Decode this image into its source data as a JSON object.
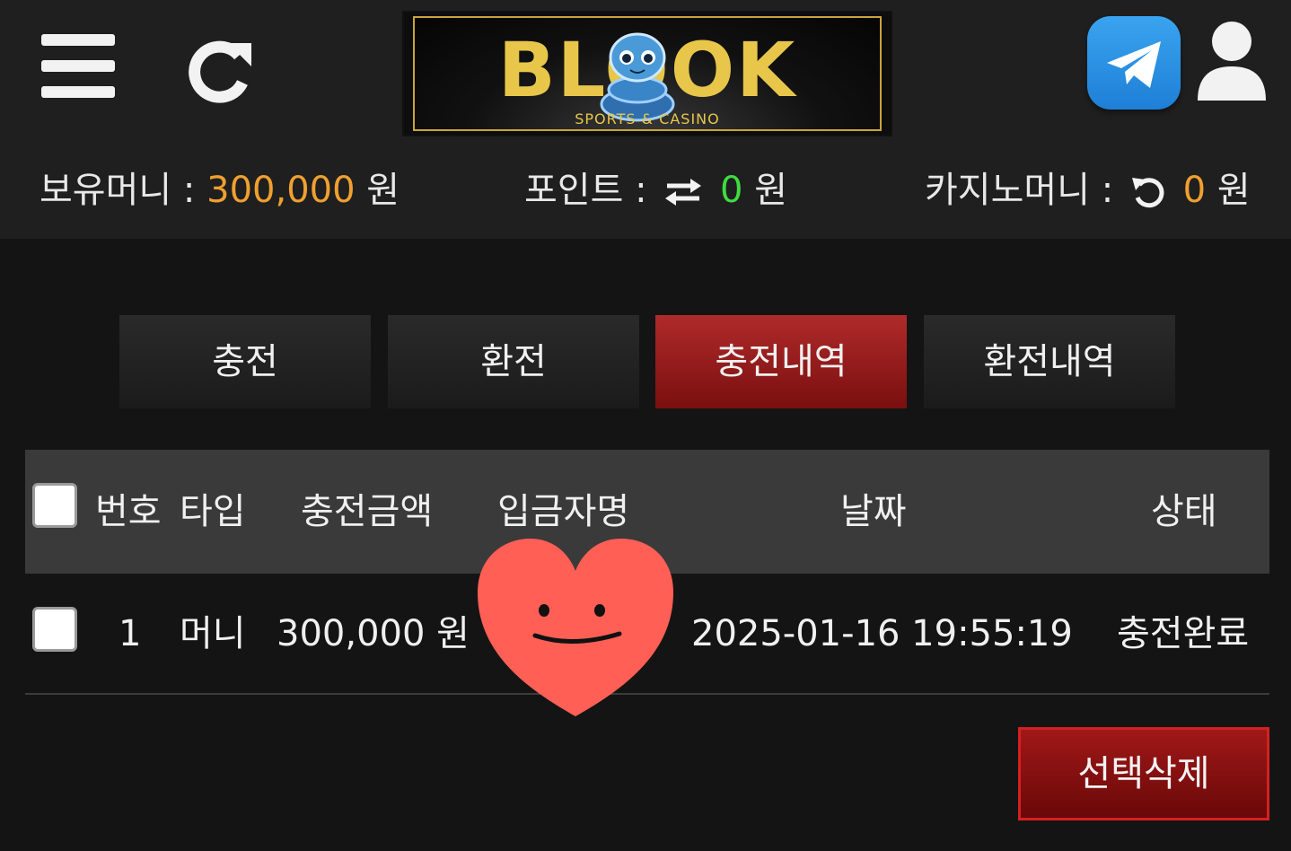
{
  "header": {
    "menu_icon": "hamburger-menu-icon",
    "refresh_icon": "refresh-icon",
    "logo": {
      "brand": "BLOOK",
      "tagline": "SPORTS & CASINO"
    },
    "telegram_icon": "telegram-icon",
    "user_icon": "user-icon"
  },
  "balances": {
    "money": {
      "label": "보유머니 :",
      "value": "300,000",
      "unit": "원"
    },
    "point": {
      "label": "포인트 :",
      "value": "0",
      "unit": "원"
    },
    "casino": {
      "label": "카지노머니 :",
      "value": "0",
      "unit": "원"
    }
  },
  "tabs": [
    {
      "label": "충전",
      "active": false
    },
    {
      "label": "환전",
      "active": false
    },
    {
      "label": "충전내역",
      "active": true
    },
    {
      "label": "환전내역",
      "active": false
    }
  ],
  "table": {
    "headers": {
      "number": "번호",
      "type": "타입",
      "amount": "충전금액",
      "depositor": "입금자명",
      "date": "날짜",
      "status": "상태"
    },
    "rows": [
      {
        "number": "1",
        "type": "머니",
        "amount": "300,000 원",
        "depositor": "",
        "date": "2025-01-16 19:55:19",
        "status": "충전완료"
      }
    ]
  },
  "actions": {
    "delete_selected": "선택삭제"
  },
  "colors": {
    "accent_red": "#a01818",
    "orange": "#f0a030",
    "green": "#3fdc3f",
    "header_bg": "#1f1f1f",
    "page_bg": "#141414"
  }
}
